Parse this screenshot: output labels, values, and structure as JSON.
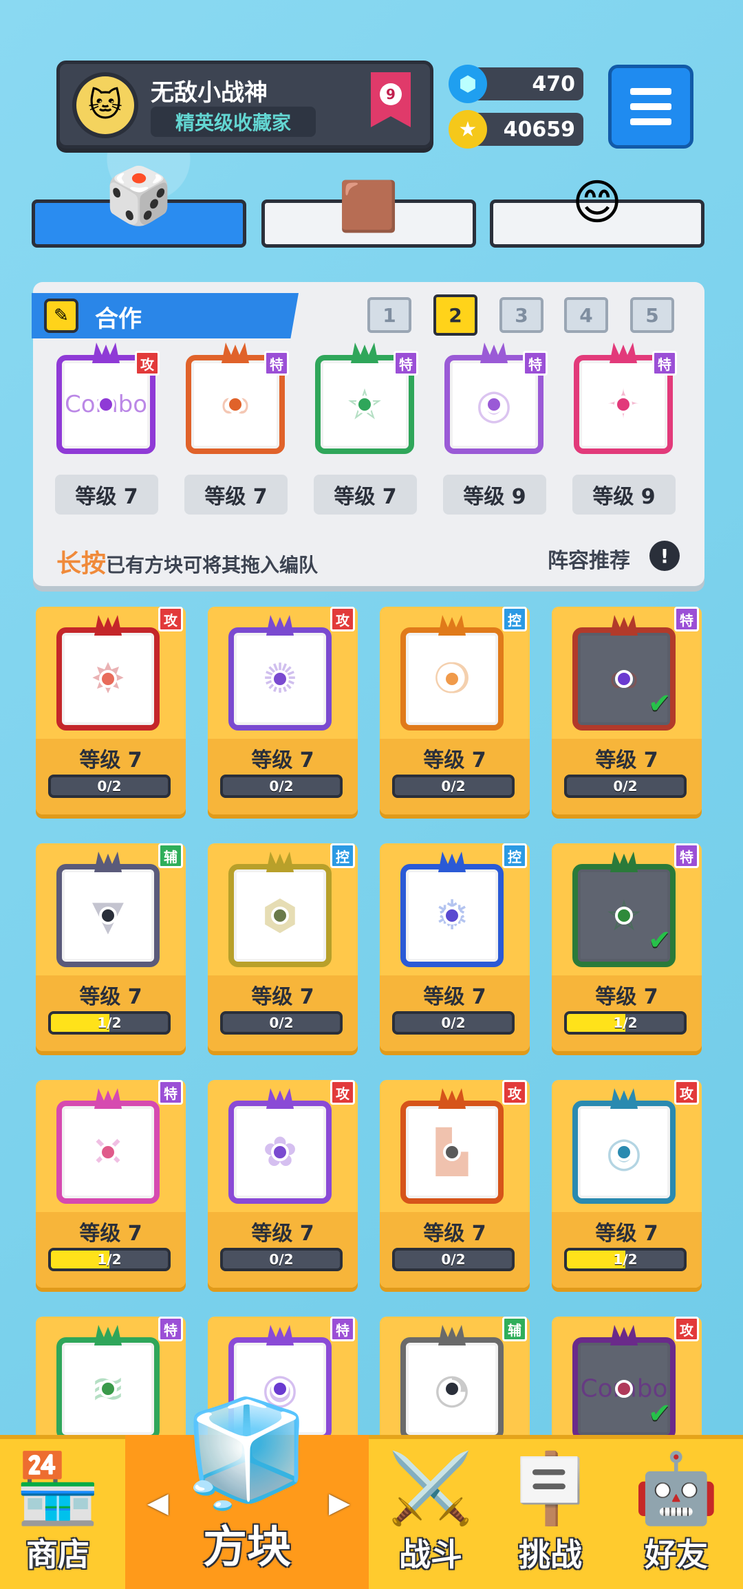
{
  "profile": {
    "name": "无敌小战神",
    "title": "精英级收藏家",
    "rank": "9",
    "avatar_icon": "cartoon-avatar-icon"
  },
  "currency": {
    "gems": "470",
    "coins": "40659"
  },
  "menu": {
    "icon": "hamburger-menu-icon"
  },
  "top_tabs": [
    {
      "name": "dice-collection",
      "icon": "dice-icon"
    },
    {
      "name": "board",
      "icon": "chocolate-board-icon"
    },
    {
      "name": "emoji",
      "icon": "smiley-cube-icon"
    }
  ],
  "deck_panel": {
    "mode_label": "合作",
    "pages": [
      "1",
      "2",
      "3",
      "4",
      "5"
    ],
    "selected_page": "2",
    "slots": [
      {
        "badge": "攻",
        "type": "atk",
        "level": "等级 7",
        "color": "#8f3ad6",
        "inner": "Combo"
      },
      {
        "badge": "特",
        "type": "spc",
        "level": "等级 7",
        "color": "#e0622a",
        "inner": "∞"
      },
      {
        "badge": "特",
        "type": "spc",
        "level": "等级 7",
        "color": "#2fa65a",
        "inner": "⛤"
      },
      {
        "badge": "特",
        "type": "spc",
        "level": "等级 9",
        "color": "#9a5ad6",
        "inner": "◎"
      },
      {
        "badge": "特",
        "type": "spc",
        "level": "等级 9",
        "color": "#e23a7a",
        "inner": "✦"
      }
    ],
    "hint_highlight": "长按",
    "hint_text": "已有方块可将其拖入编队",
    "recommend_label": "阵容推荐"
  },
  "cards": [
    {
      "badge": "攻",
      "type": "atk",
      "level": "等级 7",
      "progress": "0/2",
      "fill": 0,
      "color": "#c4262a",
      "dot": "#e86b5a",
      "pattern": "✸",
      "owned": false
    },
    {
      "badge": "攻",
      "type": "atk",
      "level": "等级 7",
      "progress": "0/2",
      "fill": 0,
      "color": "#7a4ad0",
      "dot": "#7a4ad0",
      "pattern": "✺",
      "owned": false
    },
    {
      "badge": "控",
      "type": "ctl",
      "level": "等级 7",
      "progress": "0/2",
      "fill": 0,
      "color": "#e07a1a",
      "dot": "#f09a4a",
      "pattern": "❍",
      "owned": false
    },
    {
      "badge": "特",
      "type": "spc",
      "level": "等级 7",
      "progress": "0/2",
      "fill": 0,
      "color": "#b23a2a",
      "dot": "#6a3ad0",
      "pattern": "∞",
      "owned": true
    },
    {
      "badge": "辅",
      "type": "sup",
      "level": "等级 7",
      "progress": "1/2",
      "fill": 0.5,
      "color": "#5a5a7a",
      "dot": "#2a2f3a",
      "pattern": "▼",
      "owned": false
    },
    {
      "badge": "控",
      "type": "ctl",
      "level": "等级 7",
      "progress": "0/2",
      "fill": 0,
      "color": "#b8a02a",
      "dot": "#6a7a4a",
      "pattern": "⬢",
      "owned": false
    },
    {
      "badge": "控",
      "type": "ctl",
      "level": "等级 7",
      "progress": "0/2",
      "fill": 0,
      "color": "#2a5ad6",
      "dot": "#5a4ad0",
      "pattern": "❄",
      "owned": false
    },
    {
      "badge": "特",
      "type": "spc",
      "level": "等级 7",
      "progress": "1/2",
      "fill": 0.5,
      "color": "#2a7a3a",
      "dot": "#2f8a3a",
      "pattern": "⛤",
      "owned": true
    },
    {
      "badge": "特",
      "type": "spc",
      "level": "等级 7",
      "progress": "1/2",
      "fill": 0.5,
      "color": "#d64ab0",
      "dot": "#e05a8a",
      "pattern": "✕",
      "owned": false
    },
    {
      "badge": "攻",
      "type": "atk",
      "level": "等级 7",
      "progress": "0/2",
      "fill": 0,
      "color": "#8a4ad6",
      "dot": "#7a4ad0",
      "pattern": "✿",
      "owned": false
    },
    {
      "badge": "攻",
      "type": "atk",
      "level": "等级 7",
      "progress": "0/2",
      "fill": 0,
      "color": "#d6541a",
      "dot": "#5a5a5a",
      "pattern": "▙",
      "owned": false
    },
    {
      "badge": "攻",
      "type": "atk",
      "level": "等级 7",
      "progress": "1/2",
      "fill": 0.5,
      "color": "#2a8ab0",
      "dot": "#2a8ab0",
      "pattern": "◎",
      "owned": false
    },
    {
      "badge": "特",
      "type": "spc",
      "level": "",
      "progress": "",
      "fill": 0,
      "color": "#2fa65a",
      "dot": "#3a9a4a",
      "pattern": "≋",
      "owned": false
    },
    {
      "badge": "特",
      "type": "spc",
      "level": "",
      "progress": "",
      "fill": 0,
      "color": "#8a4ad6",
      "dot": "#6a3ad0",
      "pattern": "◉",
      "owned": false
    },
    {
      "badge": "辅",
      "type": "sup",
      "level": "",
      "progress": "",
      "fill": 0,
      "color": "#6a6a6a",
      "dot": "#2a2f3a",
      "pattern": "◔",
      "owned": false
    },
    {
      "badge": "攻",
      "type": "atk",
      "level": "",
      "progress": "",
      "fill": 0,
      "color": "#6a2a8a",
      "dot": "#b03a5a",
      "pattern": "Combo",
      "owned": true
    }
  ],
  "bottom_nav": [
    {
      "label": "商店",
      "icon": "shop-icon"
    },
    {
      "label": "方块",
      "icon": "cube-icon"
    },
    {
      "label": "战斗",
      "icon": "battle-icon"
    },
    {
      "label": "挑战",
      "icon": "challenge-icon"
    },
    {
      "label": "好友",
      "icon": "friends-icon"
    }
  ]
}
